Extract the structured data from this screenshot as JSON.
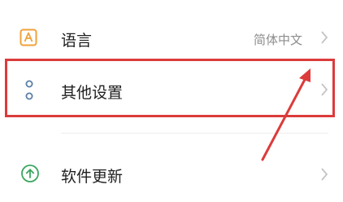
{
  "settings": {
    "items": [
      {
        "icon": "letter-a-icon",
        "label": "语言",
        "value": "简体中文"
      },
      {
        "icon": "two-dots-icon",
        "label": "其他设置",
        "value": ""
      },
      {
        "icon": "arrow-up-circle-icon",
        "label": "软件更新",
        "value": ""
      }
    ]
  },
  "colors": {
    "highlight": "#dc3b3b",
    "language_icon": "#f0a23a",
    "more_icon": "#5a7fa6",
    "update_icon": "#3aa65f"
  }
}
